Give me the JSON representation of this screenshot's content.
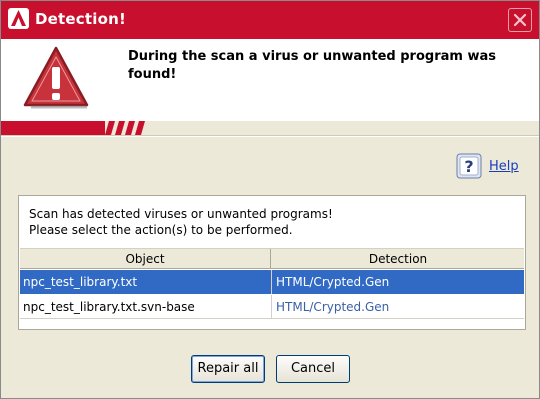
{
  "window": {
    "title": "Detection!",
    "header_message": "During the scan a virus or unwanted program was found!",
    "help_label": "Help"
  },
  "panel": {
    "instruction_line1": "Scan has detected viruses or unwanted programs!",
    "instruction_line2": "Please select the action(s) to be performed."
  },
  "table": {
    "columns": [
      "Object",
      "Detection"
    ],
    "rows": [
      {
        "object": "npc_test_library.txt",
        "detection": "HTML/Crypted.Gen",
        "selected": true
      },
      {
        "object": "npc_test_library.txt.svn-base",
        "detection": "HTML/Crypted.Gen",
        "selected": false
      }
    ]
  },
  "buttons": {
    "repair_all": "Repair all",
    "cancel": "Cancel"
  },
  "colors": {
    "brand_red": "#c8102e",
    "selection": "#316ac5",
    "link": "#1a3dbb"
  },
  "icons": [
    "app-icon",
    "close-icon",
    "warning-icon",
    "help-icon"
  ]
}
